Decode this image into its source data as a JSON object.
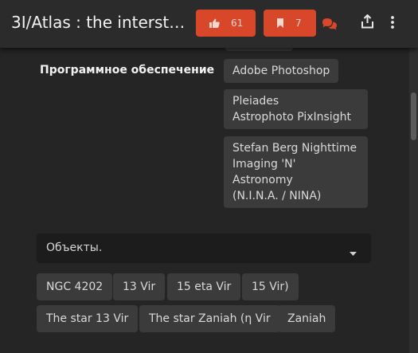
{
  "header": {
    "title": "3I/Atlas : the interst…",
    "like_count": "61",
    "bookmark_count": "7"
  },
  "software": {
    "label": "Программное обеспечение",
    "items": [
      {
        "line1": "Adobe Photoshop"
      },
      {
        "line1": "Pleiades",
        "line2": "Astrophoto PixInsight"
      },
      {
        "line1": "Stefan Berg Nighttime",
        "line2": "Imaging 'N' Astronomy",
        "line3": "(N.I.N.A. / NINA)"
      }
    ]
  },
  "objects": {
    "label": "Объекты.",
    "tags": [
      "NGC 4202",
      "13 Vir",
      "15 eta Vir",
      "15 Vir)",
      "The star 13 Vir",
      "The star Zaniah (η Vir",
      "Zaniah"
    ]
  },
  "colors": {
    "accent": "#d9472b",
    "background": "#252525",
    "chip": "#3b3b3b"
  },
  "icons": [
    "thumbs-up-icon",
    "bookmark-icon",
    "chat-icon",
    "share-icon",
    "more-vertical-icon",
    "caret-down-icon"
  ]
}
